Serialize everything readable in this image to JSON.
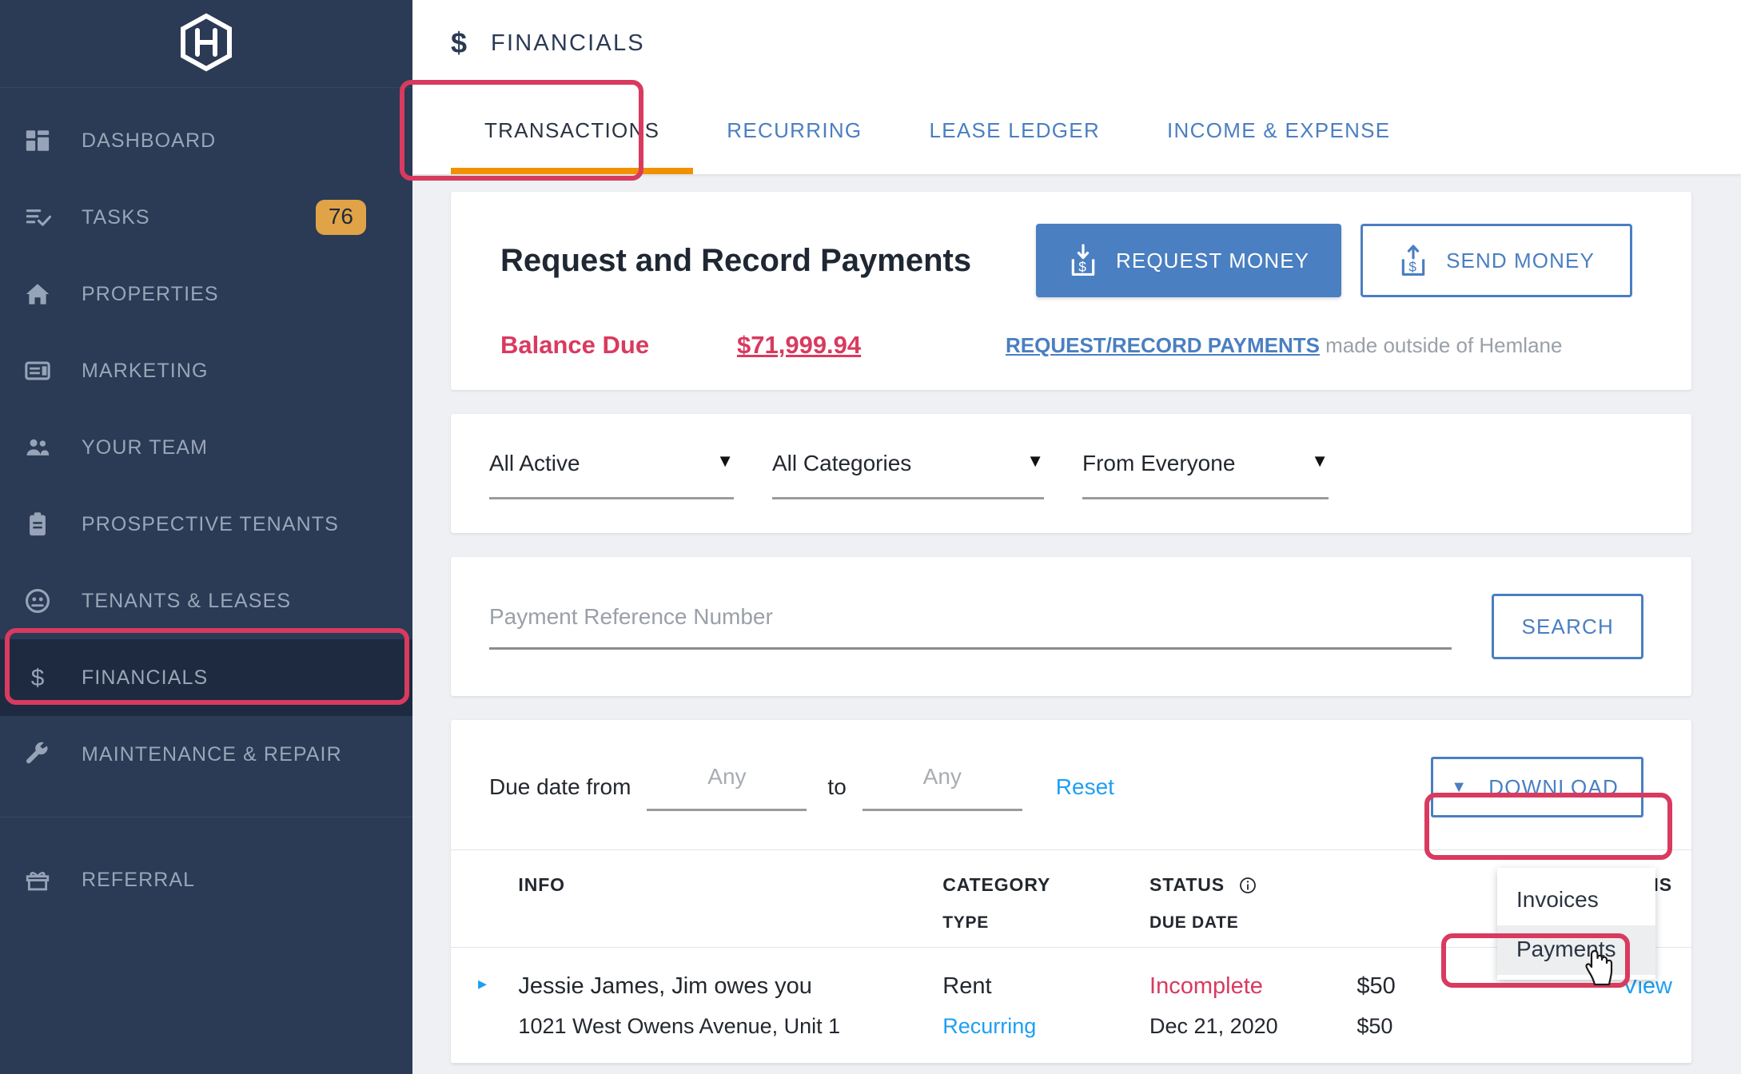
{
  "sidebar": {
    "logo": "hemlane-hexagon-logo",
    "items": [
      {
        "label": "DASHBOARD",
        "icon": "dashboard-icon"
      },
      {
        "label": "TASKS",
        "icon": "tasks-icon",
        "badge": "76"
      },
      {
        "label": "PROPERTIES",
        "icon": "home-icon"
      },
      {
        "label": "MARKETING",
        "icon": "marketing-icon"
      },
      {
        "label": "YOUR TEAM",
        "icon": "people-icon"
      },
      {
        "label": "PROSPECTIVE TENANTS",
        "icon": "clipboard-icon"
      },
      {
        "label": "TENANTS & LEASES",
        "icon": "face-icon"
      },
      {
        "label": "FINANCIALS",
        "icon": "dollar-icon",
        "active": true
      },
      {
        "label": "MAINTENANCE & REPAIR",
        "icon": "wrench-icon"
      },
      {
        "label": "REFERRAL",
        "icon": "gift-icon"
      }
    ]
  },
  "header": {
    "icon": "dollar-icon",
    "title": "FINANCIALS"
  },
  "tabs": [
    {
      "label": "TRANSACTIONS",
      "active": true
    },
    {
      "label": "RECURRING",
      "active": false
    },
    {
      "label": "LEASE LEDGER",
      "active": false
    },
    {
      "label": "INCOME & EXPENSE",
      "active": false
    }
  ],
  "payments_card": {
    "title": "Request and Record Payments",
    "request_money_label": "REQUEST MONEY",
    "send_money_label": "SEND MONEY",
    "balance_label": "Balance Due",
    "balance_amount": "$71,999.94",
    "outside_link": "REQUEST/RECORD PAYMENTS",
    "outside_text": " made outside of Hemlane"
  },
  "filters": {
    "status": "All Active",
    "category": "All Categories",
    "from": "From Everyone",
    "caret": "▼"
  },
  "search": {
    "placeholder": "Payment Reference Number",
    "value": "",
    "button_label": "SEARCH"
  },
  "duedate": {
    "label": "Due date from",
    "from_placeholder": "Any",
    "to_label": "to",
    "to_placeholder": "Any",
    "reset_label": "Reset"
  },
  "download": {
    "button_label": "DOWNLOAD",
    "caret": "▼",
    "menu": [
      {
        "label": "Invoices",
        "hovered": false
      },
      {
        "label": "Payments",
        "hovered": true
      }
    ]
  },
  "table": {
    "headers": {
      "info": "INFO",
      "category": "CATEGORY",
      "category_sub": "TYPE",
      "status": "STATUS",
      "status_sub": "DUE DATE",
      "amount": "",
      "actions": "ACTIONS"
    },
    "rows": [
      {
        "expand": "▸",
        "info": "Jessie James, Jim owes you",
        "info_sub": "1021 West Owens Avenue, Unit 1",
        "category": "Rent",
        "category_sub": "Recurring",
        "status": "Incomplete",
        "status_sub": "Dec 21, 2020",
        "amount": "$50",
        "amount_sub": "$50",
        "action": "View"
      }
    ]
  },
  "colors": {
    "sidebar_bg": "#2b3a55",
    "sidebar_active_bg": "#1e2a40",
    "accent_blue": "#4a7fc1",
    "link_blue": "#1e9ff2",
    "highlight_red": "#d93a5f",
    "tab_underline": "#f29100",
    "badge_amber": "#e0a347"
  },
  "cursor": {
    "type": "pointing-hand"
  }
}
